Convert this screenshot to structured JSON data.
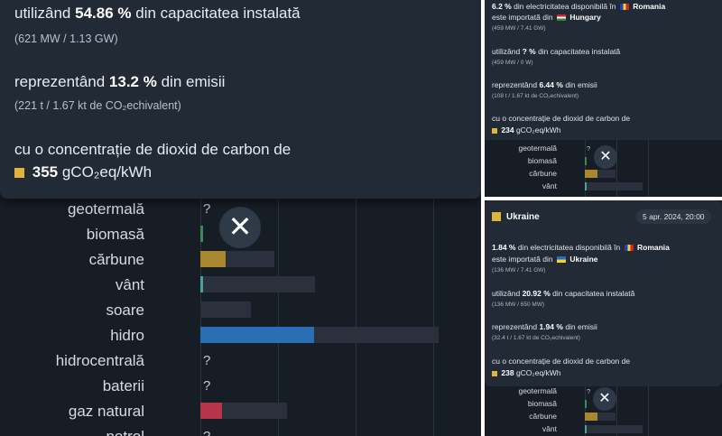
{
  "left": {
    "tooltip": {
      "capacity_line": {
        "prefix": "utilizând",
        "value": "54.86 %",
        "suffix": "din capacitatea instalată"
      },
      "capacity_sub": "(621 MW / 1.13 GW)",
      "emissions_line": {
        "prefix": "reprezentând",
        "value": "13.2 %",
        "suffix": "din emisii"
      },
      "emissions_sub": "(221 t / 1.67 kt de CO₂echivalent)",
      "intensity_line": "cu o concentrație de dioxid de carbon de",
      "intensity_value": "355",
      "intensity_unit": "gCO₂eq/kWh"
    },
    "rows": [
      {
        "label": "geotermală",
        "missing": "?",
        "value": null
      },
      {
        "label": "biomasă",
        "missing": "",
        "value": 0.01
      },
      {
        "label": "cărbune",
        "missing": "",
        "value": 0.1
      },
      {
        "label": "vânt",
        "missing": "",
        "value": 0.01
      },
      {
        "label": "soare",
        "missing": "",
        "value": 0
      },
      {
        "label": "hidro",
        "missing": "",
        "value": 0.48
      },
      {
        "label": "hidrocentrală",
        "missing": "?",
        "value": null
      },
      {
        "label": "baterii",
        "missing": "?",
        "value": null
      },
      {
        "label": "gaz natural",
        "missing": "",
        "value": 0.09
      },
      {
        "label": "petrol",
        "missing": "?",
        "value": null
      }
    ],
    "close_symbol": "✕"
  },
  "top_right": {
    "import_line1": {
      "value": "6.2 %",
      "text": "din electricitatea disponibilă în",
      "country": "Romania"
    },
    "import_line2": {
      "text": "este importată din",
      "country": "Hungary"
    },
    "import_sub": "(459 MW / 7.41 GW)",
    "capacity_line": {
      "prefix": "utilizând",
      "value": "? %",
      "suffix": "din capacitatea instalată"
    },
    "capacity_sub": "(459 MW / 0 W)",
    "emissions_line": {
      "prefix": "reprezentând",
      "value": "6.44 %",
      "suffix": "din emisii"
    },
    "emissions_sub": "(108 t / 1.67 kt de CO₂echivalent)",
    "intensity_line": "cu o concentrație de dioxid de carbon de",
    "intensity_value": "234",
    "intensity_unit": "gCO₂eq/kWh",
    "rows": [
      {
        "label": "geotermală",
        "missing": "?"
      },
      {
        "label": "biomasă",
        "missing": ""
      },
      {
        "label": "cărbune",
        "missing": ""
      },
      {
        "label": "vânt",
        "missing": ""
      }
    ],
    "close_symbol": "✕"
  },
  "bottom_right": {
    "zone_name": "Ukraine",
    "date": "5 apr. 2024, 20:00",
    "import_line1": {
      "value": "1.84 %",
      "text": "din electricitatea disponibilă în",
      "country": "Romania"
    },
    "import_line2": {
      "text": "este importată din",
      "country": "Ukraine"
    },
    "import_sub": "(136 MW / 7.41 GW)",
    "capacity_line": {
      "prefix": "utilizând",
      "value": "20.92 %",
      "suffix": "din capacitatea instalată"
    },
    "capacity_sub": "(136 MW / 650 MW)",
    "emissions_line": {
      "prefix": "reprezentând",
      "value": "1.94 %",
      "suffix": "din emisii"
    },
    "emissions_sub": "(32.4 t / 1.67 kt de CO₂echivalent)",
    "intensity_line": "cu o concentrație de dioxid de carbon de",
    "intensity_value": "238",
    "intensity_unit": "gCO₂eq/kWh",
    "rows": [
      {
        "label": "geotermală",
        "missing": "?"
      },
      {
        "label": "biomasă",
        "missing": ""
      },
      {
        "label": "cărbune",
        "missing": ""
      },
      {
        "label": "vânt",
        "missing": ""
      }
    ],
    "close_symbol": "✕"
  },
  "colors": {
    "background": "#171d25",
    "tooltip": "#222a36",
    "carbon_square": "#e0b43a",
    "coal": "#a8872f",
    "hydro": "#2a6fb5",
    "gas": "#b8344b",
    "wind": "#4aa39a",
    "biomass": "#3c8a57",
    "track": "#2a313c"
  }
}
